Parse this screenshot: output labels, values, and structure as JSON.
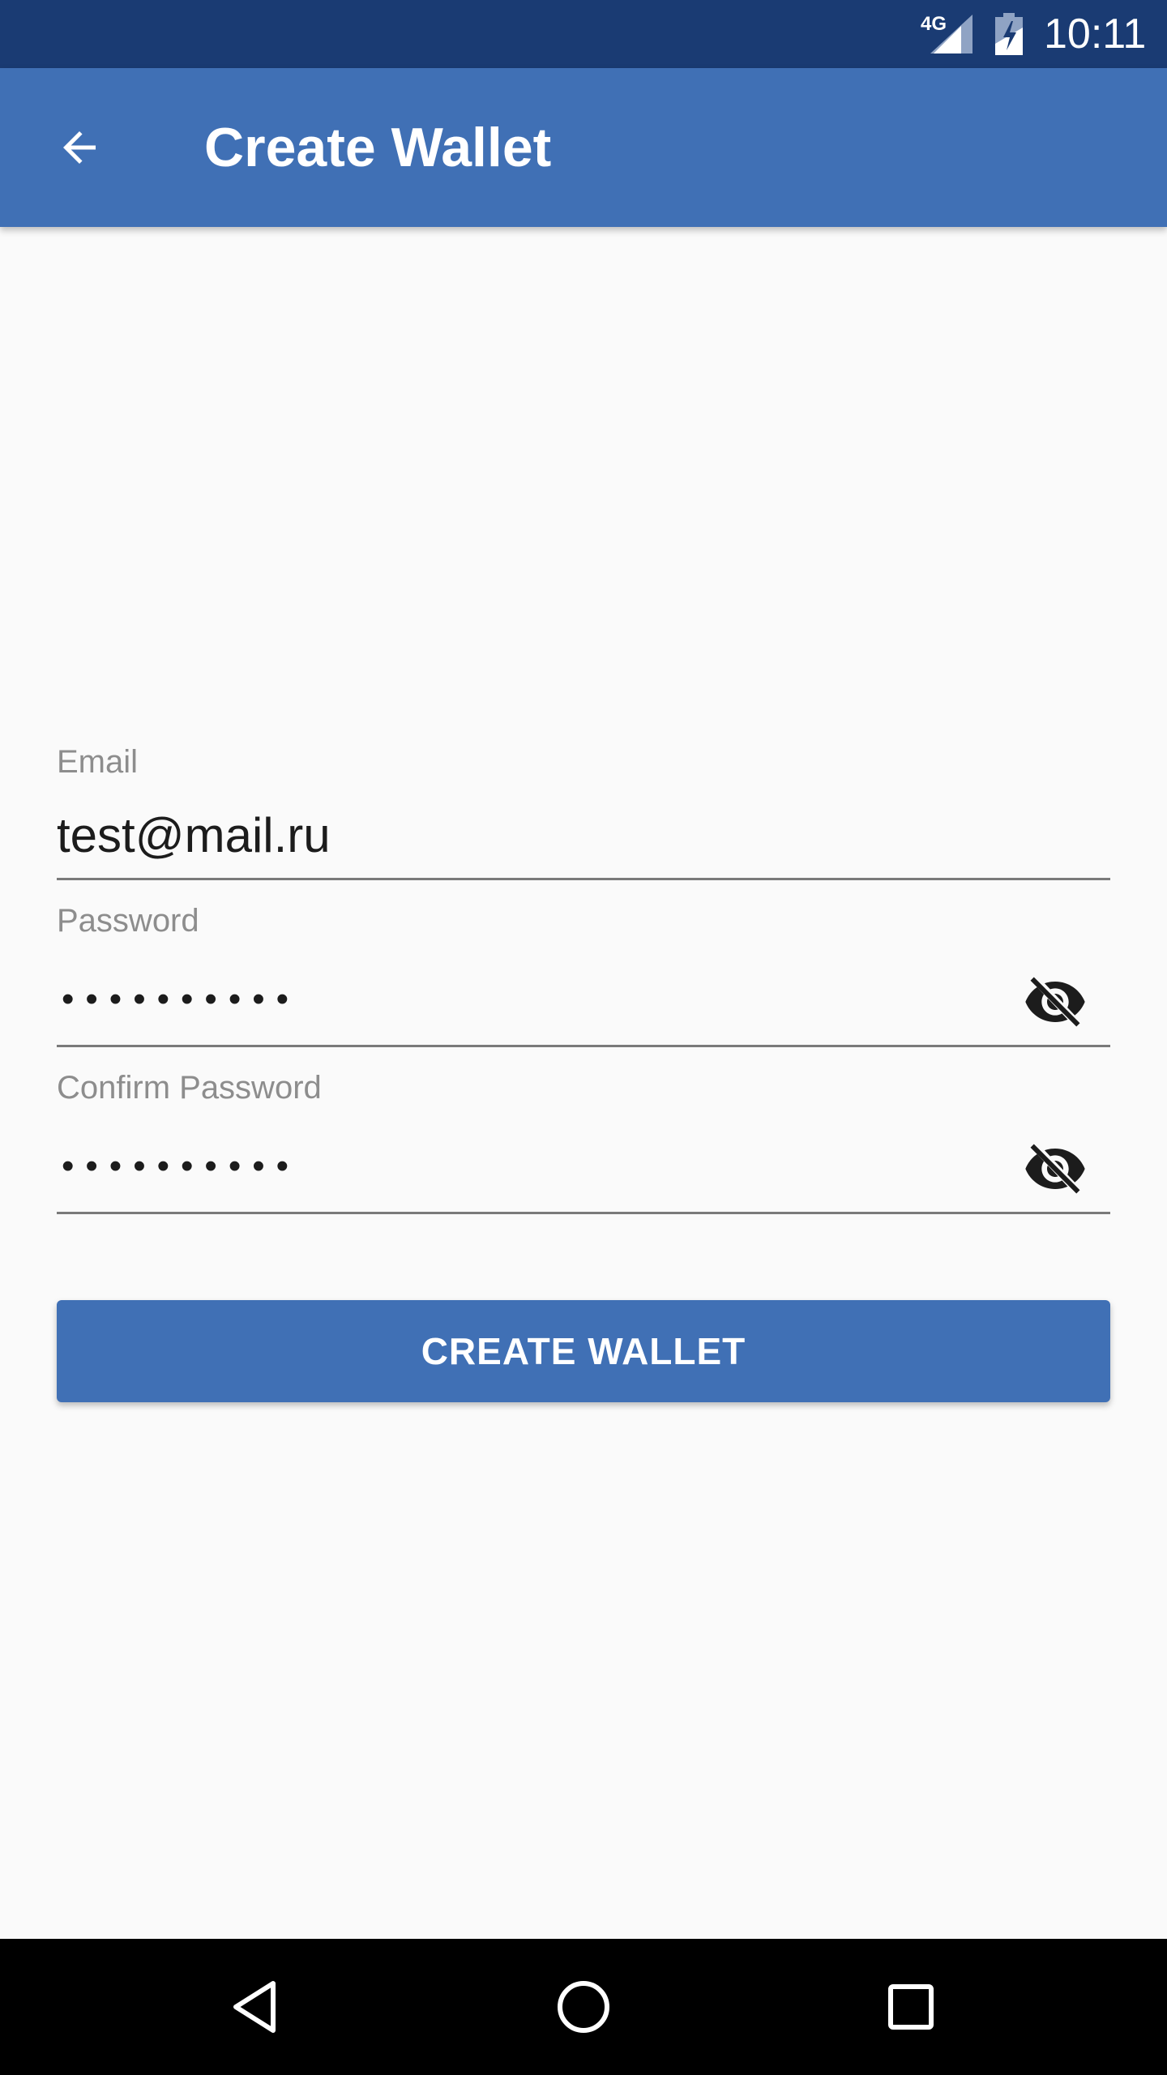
{
  "status_bar": {
    "network_type": "4G",
    "time": "10:11",
    "signal_icon": "cellular-signal-icon",
    "battery_icon": "battery-charging-icon"
  },
  "app_bar": {
    "title": "Create Wallet",
    "back_icon": "arrow-back-icon"
  },
  "form": {
    "email": {
      "label": "Email",
      "value": "test@mail.ru"
    },
    "password": {
      "label": "Password",
      "masked_value": "••••••••••",
      "toggle_icon": "visibility-off-icon"
    },
    "confirm_password": {
      "label": "Confirm Password",
      "masked_value": "••••••••••",
      "toggle_icon": "visibility-off-icon"
    },
    "submit_label": "CREATE WALLET"
  },
  "nav_bar": {
    "back_icon": "nav-back-triangle-icon",
    "home_icon": "nav-home-circle-icon",
    "recents_icon": "nav-recents-square-icon"
  },
  "colors": {
    "status_bar": "#1a3b73",
    "primary": "#4070b5",
    "background": "#fafafa",
    "label_text": "#8d8d8d",
    "value_text": "#1c1c1c",
    "underline": "#7a7a7a"
  }
}
